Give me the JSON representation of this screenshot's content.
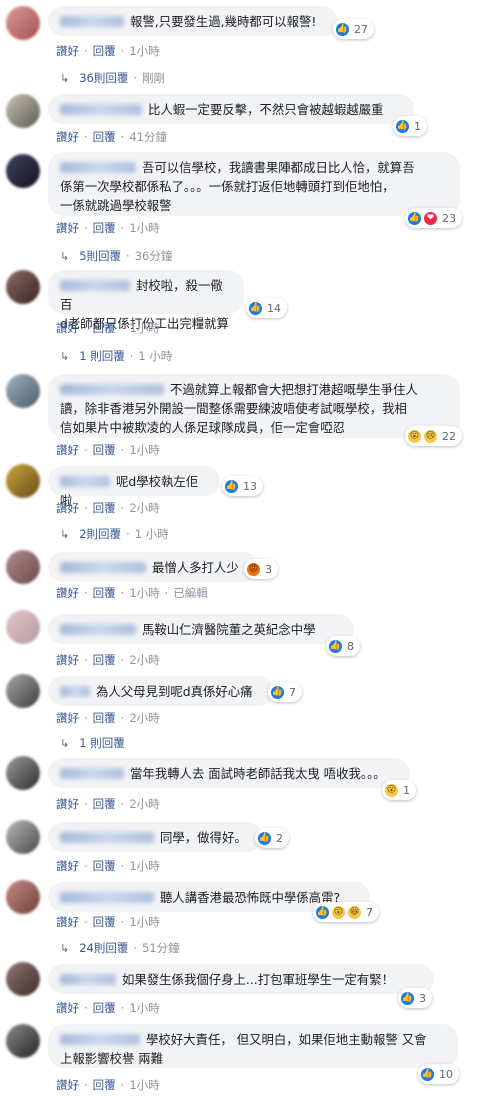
{
  "common": {
    "like_label": "讚好",
    "reply_label": "回覆",
    "dot": "·"
  },
  "comments": [
    {
      "text": "報警,只要發生過,幾時都可以報警!",
      "reactions": [
        "like"
      ],
      "count": "27",
      "time": "1小時",
      "replies": {
        "label": "36則回覆",
        "time": "剛剛"
      }
    },
    {
      "text": "比人蝦一定要反擊，不然只會被越蝦越嚴重",
      "reactions": [
        "like"
      ],
      "count": "1",
      "time": "41分鐘"
    },
    {
      "lines": [
        "吾可以信學校，我讀書果陣都成日比人恰，就算吾",
        "係第一次學校都係私了。。。一係就打返佢地轉頭打到佢地怕，",
        "一係就跳過學校報警"
      ],
      "reactions": [
        "like",
        "love"
      ],
      "count": "23",
      "time": "1小時",
      "replies": {
        "label": "5則回覆",
        "time": "36分鐘"
      }
    },
    {
      "lines": [
        "封校啦，殺一儆百",
        "d老師都只係打份工出完糧就算"
      ],
      "reactions": [
        "like"
      ],
      "count": "14",
      "time": "1小時",
      "replies": {
        "label": "1 則回覆",
        "time": "1 小時"
      }
    },
    {
      "lines": [
        "不過就算上報都會大把想打港超嘅學生爭住人",
        "讀，除非香港另外開設一間整係需要練波唔使考試嘅學校，我相",
        "信如果片中被欺凌的人係足球隊成員，佢一定會啞忍"
      ],
      "reactions": [
        "wow",
        "sad"
      ],
      "count": "22",
      "time": "1小時"
    },
    {
      "text": "呢d學校執左佢啦",
      "reactions": [
        "like"
      ],
      "count": "13",
      "time": "2小時",
      "replies": {
        "label": "2則回覆",
        "time": "1 小時"
      }
    },
    {
      "text": "最憎人多打人少",
      "reactions": [
        "angry"
      ],
      "count": "3",
      "time": "1小時",
      "edited": "已編輯"
    },
    {
      "text": "馬鞍山仁濟醫院董之英紀念中學",
      "reactions": [
        "like"
      ],
      "count": "8",
      "time": "2小時"
    },
    {
      "text": "為人父母見到呢d真係好心痛",
      "reactions": [
        "like"
      ],
      "count": "7",
      "time": "2小時",
      "replies": {
        "label": "1 則回覆",
        "time": ""
      }
    },
    {
      "text": "當年我轉人去 面試時老師話我太曳 唔收我。。。",
      "reactions": [
        "wow"
      ],
      "count": "1",
      "time": "2小時"
    },
    {
      "text": "同學，做得好。",
      "reactions": [
        "like"
      ],
      "count": "2",
      "time": "1小時"
    },
    {
      "text": "聽人講香港最恐怖既中學係高雷?",
      "reactions": [
        "like",
        "wow",
        "haha"
      ],
      "count": "7",
      "time": "1小時",
      "replies": {
        "label": "24則回覆",
        "time": "51分鐘"
      }
    },
    {
      "text": "如果發生係我個仔身上...打包軍班學生一定有緊！",
      "reactions": [
        "like"
      ],
      "count": "3",
      "time": "1小時"
    },
    {
      "lines": [
        "學校好大責任， 但又明白，如果佢地主動報警 又會",
        "上報影響校譽 兩難"
      ],
      "reactions": [
        "like"
      ],
      "count": "10",
      "time": "1小時"
    }
  ],
  "reaction_glyphs": {
    "like": "👍",
    "love": "❤",
    "wow": "😮",
    "sad": "😢",
    "haha": "😆",
    "angry": "😡"
  }
}
